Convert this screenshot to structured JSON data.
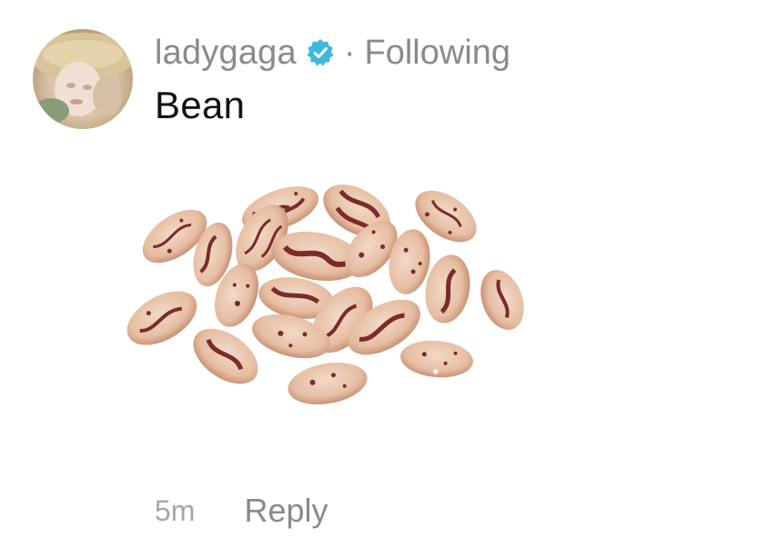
{
  "comment": {
    "username": "ladygaga",
    "separator": "·",
    "follow_status": "Following",
    "text": "Bean",
    "timestamp": "5m",
    "reply_label": "Reply",
    "verified_icon": "verified-badge-icon",
    "media_subject": "pinto-beans-image"
  },
  "colors": {
    "meta_text": "#8a8a8e",
    "body_text": "#111111",
    "verified_badge": "#3fb8de",
    "background": "#ffffff"
  }
}
